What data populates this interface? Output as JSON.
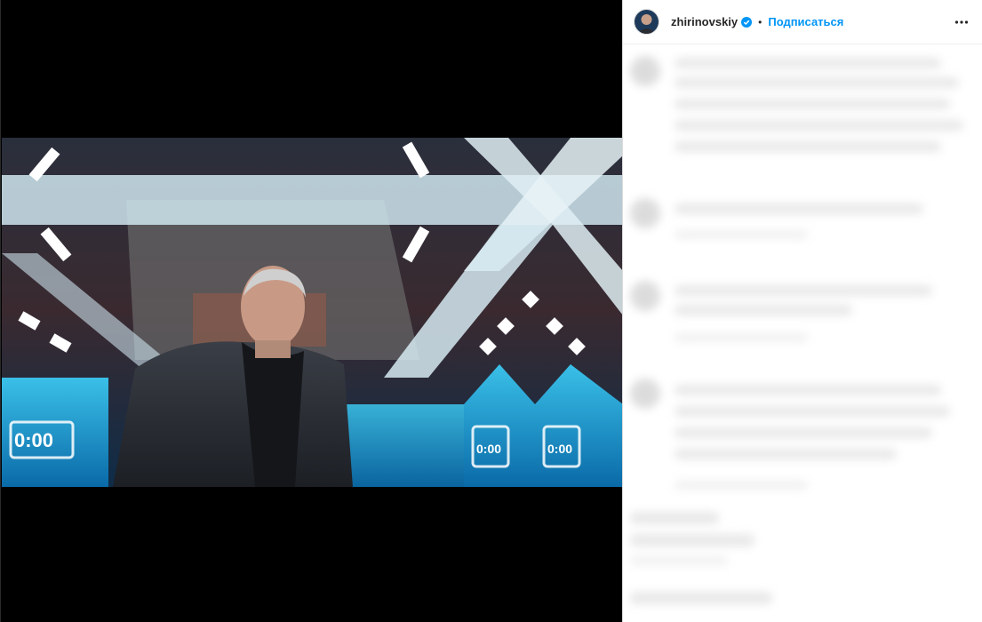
{
  "post": {
    "username": "zhirinovskiy",
    "separator": "•",
    "follow_label": "Подписаться",
    "verified": true
  },
  "media": {
    "screen_readouts": [
      "0:00",
      "0:00",
      "0:00"
    ]
  },
  "icons": {
    "more": "more-horizontal-icon",
    "verified": "verified-badge-icon"
  },
  "colors": {
    "accent": "#0095f6",
    "text": "#262626",
    "verified": "#0095f6"
  }
}
